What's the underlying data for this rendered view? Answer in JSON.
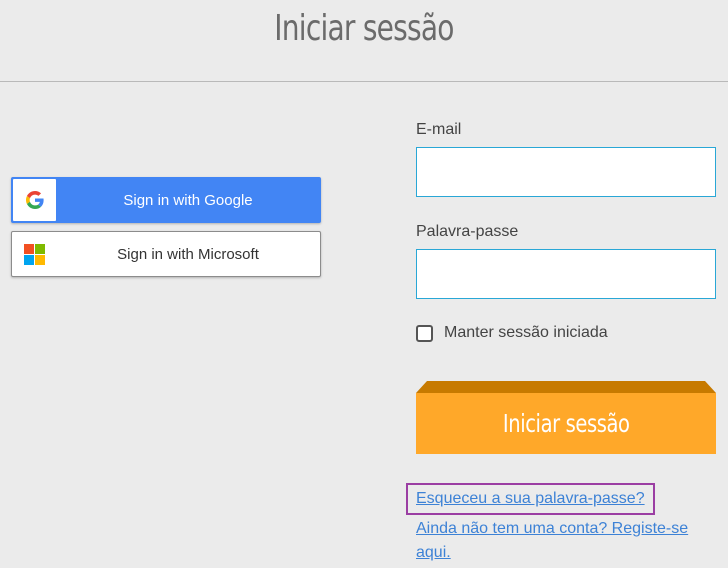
{
  "header": {
    "title": "Iniciar sessão"
  },
  "social": {
    "google_label": "Sign in with Google",
    "microsoft_label": "Sign in with Microsoft"
  },
  "form": {
    "email_label": "E-mail",
    "email_value": "",
    "password_label": "Palavra-passe",
    "password_value": "",
    "remember_label": "Manter sessão iniciada",
    "remember_checked": false,
    "submit_label": "Iniciar sessão"
  },
  "links": {
    "forgot": "Esqueceu a sua palavra-passe?",
    "register_line1": "Ainda não tem uma conta? Registe-se",
    "register_line2": "aqui."
  },
  "colors": {
    "background": "#ebebeb",
    "google_blue": "#4285f4",
    "input_border": "#29a7d6",
    "submit_orange": "#ffa829",
    "submit_top": "#c77a00",
    "link_blue": "#3d82d6",
    "highlight_purple": "#9b3ea3"
  }
}
